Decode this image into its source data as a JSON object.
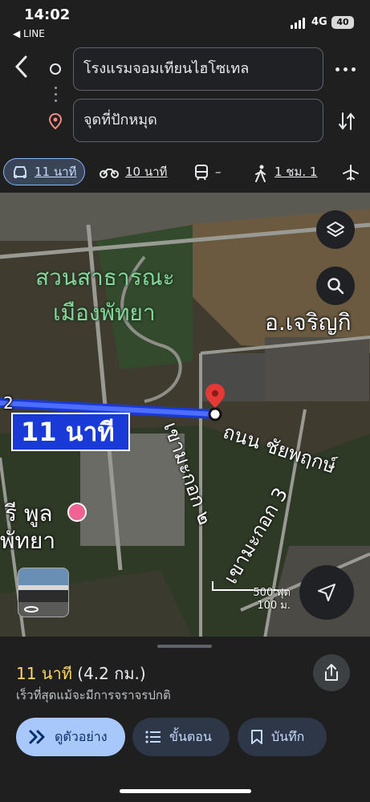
{
  "status_bar": {
    "time": "14:02",
    "back_app": "◀ LINE",
    "network": "4G",
    "battery": "40"
  },
  "route": {
    "from_value": "โรงแรมจอมเทียนไฮโซเทล",
    "to_value": "จุดที่ปักหมุด"
  },
  "modes": [
    {
      "name": "drive",
      "label": "11 นาที",
      "active": true
    },
    {
      "name": "motorbike",
      "label": "10 นาที",
      "active": false
    },
    {
      "name": "transit",
      "label": "–",
      "active": false
    },
    {
      "name": "walk",
      "label": "1 ชม. 1",
      "active": false
    },
    {
      "name": "flight",
      "label": "",
      "active": false
    }
  ],
  "map": {
    "park_label_line1": "สวนสาธารณะ",
    "park_label_line2": "เมืองพัทยา",
    "district_label": "อ.เจริญกิ",
    "road_label_1": "ถนน ชัยพฤกษ์",
    "road_label_2": "เขามะกอก ๒",
    "road_label_3": "เขามะกอก 3",
    "hotel_label_line1": "รี พูล",
    "hotel_label_line2": "พัทยา",
    "eta_callout": "11 นาที",
    "route_num": "2",
    "scale_ft": "500 ฟุต",
    "scale_m": "100 ม."
  },
  "summary": {
    "eta_time": "11 นาที",
    "eta_distance": "(4.2 กม.)",
    "subtitle": "เร็วที่สุดแม้จะมีการจราจรปกติ"
  },
  "actions": {
    "preview_label": "ดูตัวอย่าง",
    "steps_label": "ขั้นตอน",
    "save_label": "บันทึก"
  },
  "colors": {
    "accent": "#a8c7fa",
    "route": "#1a3ad8",
    "eta": "#fdd663",
    "pin": "#e53935"
  }
}
